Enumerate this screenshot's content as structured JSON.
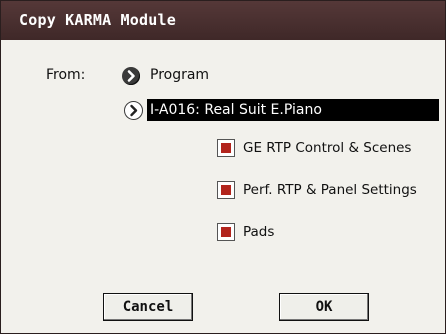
{
  "dialog": {
    "title": "Copy KARMA Module",
    "from_label": "From:",
    "source_type": "Program",
    "program": "I-A016: Real Suit E.Piano",
    "options": [
      {
        "label": "GE RTP Control & Scenes",
        "checked": true
      },
      {
        "label": "Perf. RTP & Panel Settings",
        "checked": true
      },
      {
        "label": "Pads",
        "checked": true
      }
    ],
    "cancel_label": "Cancel",
    "ok_label": "OK"
  },
  "colors": {
    "titlebar": "#4a3030",
    "dialog_bg": "#f2f1ec",
    "checkbox_mark": "#b2241c",
    "program_field_bg": "#000000"
  },
  "icons": {
    "source_arrow": "circle-right-arrow-icon",
    "program_arrow": "circle-right-arrow-icon"
  }
}
